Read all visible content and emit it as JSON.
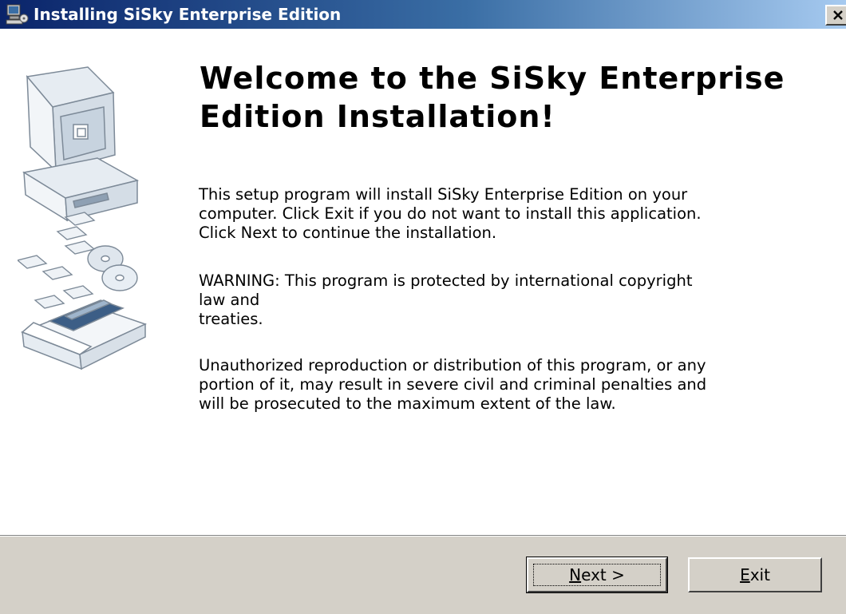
{
  "window": {
    "title": "Installing SiSky Enterprise Edition",
    "close_symbol": "×"
  },
  "welcome": {
    "heading": "Welcome to the SiSky Enterprise Edition Installation!",
    "paragraph1": "This setup program will install SiSky Enterprise Edition on your\ncomputer. Click Exit if you do not want to install this application.\nClick Next to continue the installation.",
    "paragraph2": "WARNING: This program is protected by international copyright\nlaw and\ntreaties.",
    "paragraph3": "Unauthorized reproduction or distribution of this program, or any\nportion of it, may result in severe civil and criminal penalties and\nwill be prosecuted to the maximum extent of the law."
  },
  "buttons": {
    "next_mnemonic": "N",
    "next_rest": "ext >",
    "exit_mnemonic": "E",
    "exit_rest": "xit"
  },
  "icons": {
    "title": "installer-computer-icon",
    "art": "computer-disks-box-illustration",
    "close": "close-icon"
  },
  "colors": {
    "titlebar_start": "#0a246a",
    "titlebar_end": "#a6caf0",
    "face": "#d4d0c8"
  }
}
